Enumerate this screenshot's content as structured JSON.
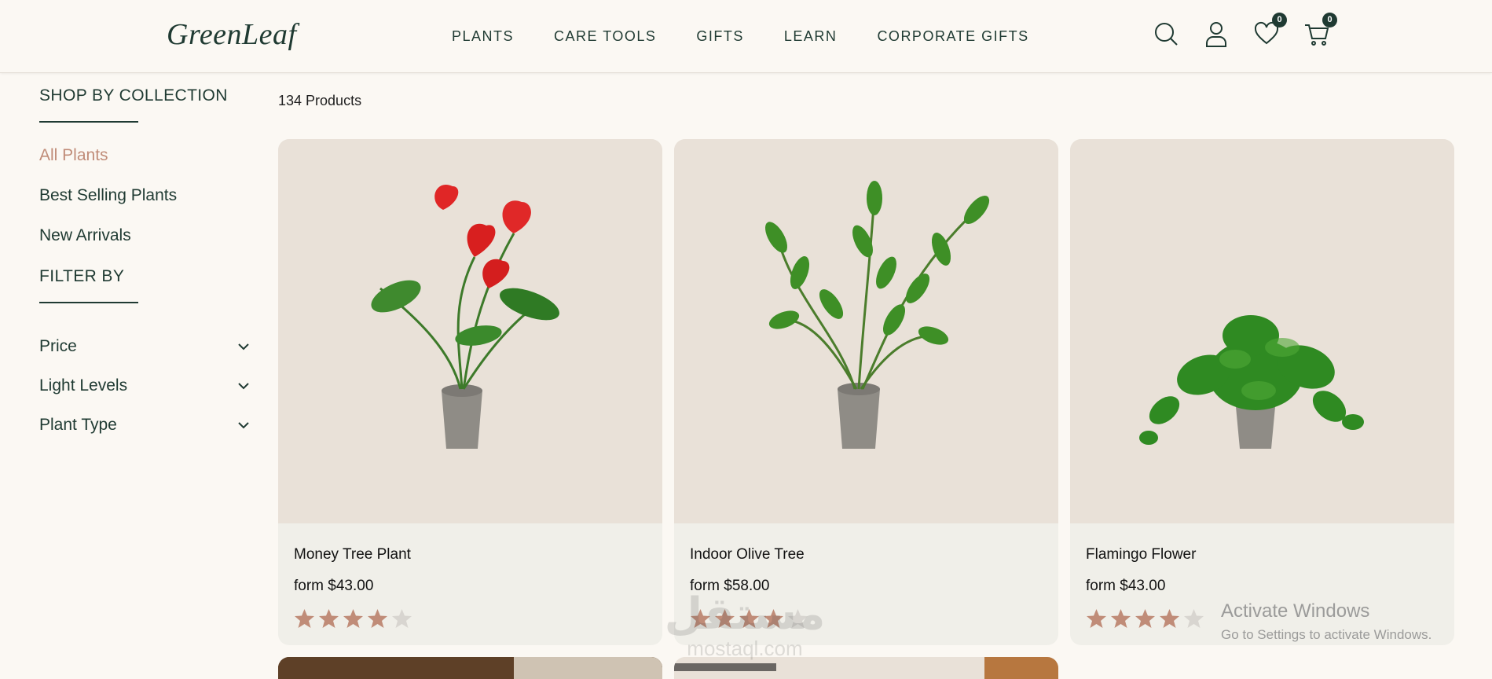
{
  "brand": {
    "logo": "GreenLeaf"
  },
  "nav": [
    {
      "label": "PLANTS"
    },
    {
      "label": "CARE TOOLS"
    },
    {
      "label": "GIFTS"
    },
    {
      "label": "LEARN"
    },
    {
      "label": "CORPORATE GIFTS"
    }
  ],
  "header_icons": {
    "search": "search-icon",
    "account": "user-icon",
    "wishlist": {
      "icon": "heart-icon",
      "count": "0"
    },
    "cart": {
      "icon": "cart-icon",
      "count": "0"
    }
  },
  "sidebar": {
    "collection_heading": "SHOP BY COLLECTION",
    "collections": [
      {
        "label": "All Plants",
        "active": true
      },
      {
        "label": "Best Selling Plants",
        "active": false
      },
      {
        "label": "New Arrivals",
        "active": false
      }
    ],
    "filter_heading": "FILTER BY",
    "filters": [
      {
        "label": "Price"
      },
      {
        "label": "Light Levels"
      },
      {
        "label": "Plant Type"
      }
    ]
  },
  "results": {
    "count_label": "134 Products"
  },
  "products": [
    {
      "name": "Money Tree Plant",
      "price": "form $43.00",
      "rating": 4,
      "max_rating": 5
    },
    {
      "name": "Indoor Olive Tree",
      "price": "form $58.00",
      "rating": 4,
      "max_rating": 5
    },
    {
      "name": "Flamingo Flower",
      "price": "form $43.00",
      "rating": 4,
      "max_rating": 5
    }
  ],
  "overlays": {
    "windows_title": "Activate Windows",
    "windows_sub": "Go to Settings to activate Windows.",
    "watermark_ar": "مستقل",
    "watermark_en": "mostaql.com"
  },
  "colors": {
    "primary": "#1f3a32",
    "accent": "#c08c78",
    "background": "#fbf8f3",
    "card": "#f0efe9",
    "star_filled": "#c08c78",
    "star_empty": "#d8d5d0"
  }
}
